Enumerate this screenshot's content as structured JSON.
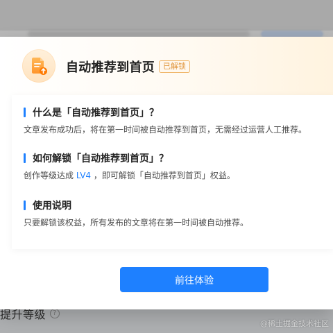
{
  "background": {
    "bottom_title": "提升等级",
    "help_icon": "help-icon",
    "watermark": "@稀土掘金技术社区"
  },
  "modal": {
    "title": "自动推荐到首页",
    "badge": "已解锁",
    "icon": "document-up-arrow-icon",
    "sections": [
      {
        "title": "什么是「自动推荐到首页」？",
        "desc": "文章发布成功后，将在第一时间被自动推荐到首页，无需经过运营人工推荐。"
      },
      {
        "title": "如何解锁「自动推荐到首页」？",
        "desc_prefix": "创作等级达成 ",
        "desc_level": "LV4",
        "desc_suffix": " ，即可解锁「自动推荐到首页」权益。"
      },
      {
        "title": "使用说明",
        "desc": "只要解锁该权益，所有发布的文章将在第一时间被自动推荐。"
      }
    ],
    "button_label": "前往体验"
  },
  "colors": {
    "accent": "#1e80ff",
    "badge_border": "#f0b86d",
    "badge_text": "#e0953b",
    "icon_orange": "#ff9d2a"
  }
}
